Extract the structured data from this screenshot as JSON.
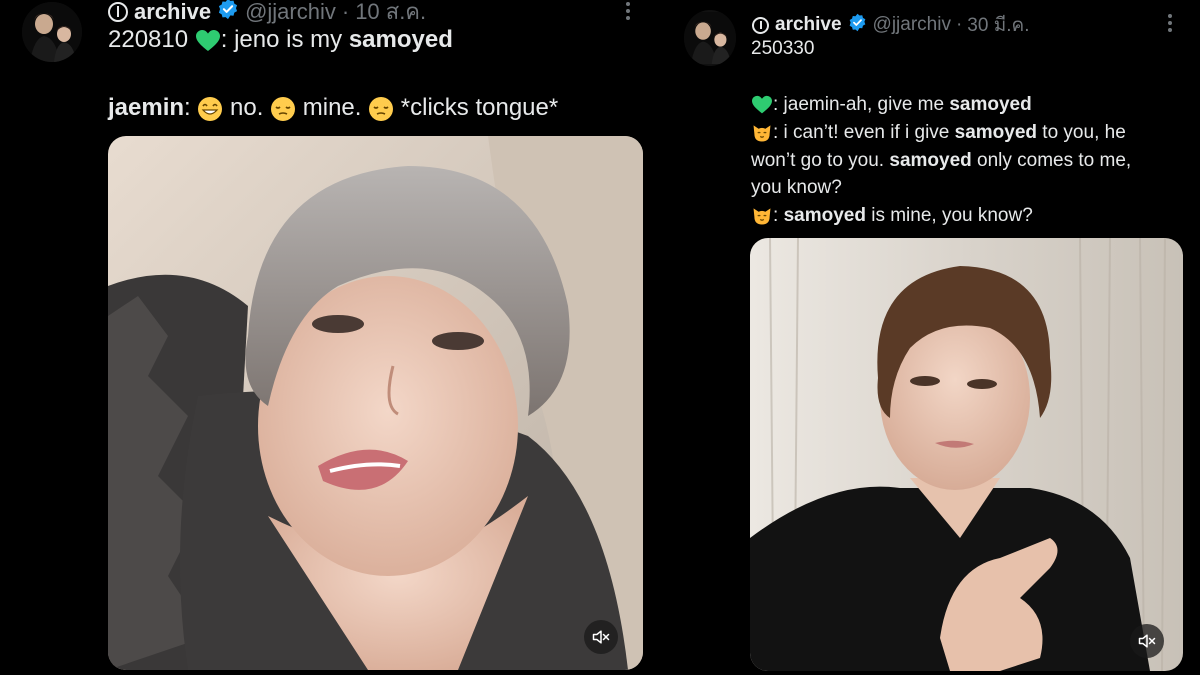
{
  "left_post": {
    "author": {
      "name": "archive",
      "handle": "@jjarchiv",
      "separator": "·",
      "date": "10 ส.ค."
    },
    "text": {
      "line1_prefix": "220810 ",
      "line1_mid": ": jeno is my ",
      "line1_bold": "samoyed",
      "line2_name": "jaemin",
      "line2_colon": ": ",
      "line2_no": " no. ",
      "line2_mine": " mine. ",
      "line2_end": " *clicks tongue*"
    },
    "media": {
      "type": "video",
      "muted": true
    }
  },
  "right_post": {
    "author": {
      "name": "archive",
      "handle": "@jjarchiv",
      "separator": "·",
      "date": "30 มี.ค."
    },
    "text": {
      "date_line": "250330",
      "l1_a": ": jaemin-ah, give me ",
      "l1_b": "samoyed",
      "l2_a": ": i can’t! even if i give ",
      "l2_b": "samoyed",
      "l2_c": " to you, he",
      "l3_a": "won’t go to you. ",
      "l3_b": "samoyed",
      "l3_c": " only comes to me,",
      "l4": "you know?",
      "l5_a": ": ",
      "l5_b": "samoyed",
      "l5_c": " is mine, you know?"
    },
    "media": {
      "type": "video",
      "muted": true
    }
  },
  "colors": {
    "background": "#000000",
    "text": "#e7e9ea",
    "secondary": "#71767b",
    "verified": "#1d9bf0",
    "heart": "#2ecc71",
    "emoji_face": "#ffcc4d",
    "cat_face": "#ffb636"
  },
  "icons": [
    "info-circle-icon",
    "verified-badge-icon",
    "more-icon",
    "green-heart-icon",
    "grinning-face-icon",
    "relieved-face-icon",
    "cat-face-icon",
    "muted-speaker-icon"
  ]
}
